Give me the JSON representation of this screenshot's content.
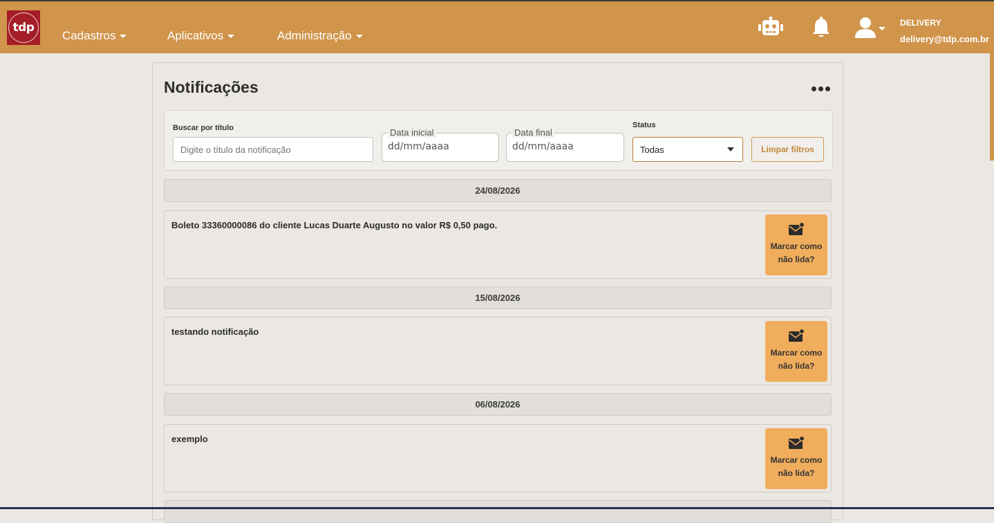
{
  "navbar": {
    "logo_text": "tdp",
    "menus": [
      {
        "label": "Cadastros"
      },
      {
        "label": "Aplicativos"
      },
      {
        "label": "Administração"
      }
    ],
    "icons": [
      "robot-icon",
      "bell-icon",
      "user-icon"
    ],
    "user": {
      "name": "DELIVERY",
      "email": "delivery@tdp.com.br"
    }
  },
  "page": {
    "title": "Notificações"
  },
  "filters": {
    "search_label": "Buscar por título",
    "search_placeholder": "Digite o título da notificação",
    "search_value": "",
    "start_date_label": "Data inicial",
    "start_date_value": "dd/mm/aaaa",
    "end_date_label": "Data final",
    "end_date_value": "dd/mm/aaaa",
    "status_label": "Status",
    "status_value": "Todas",
    "clear_label": "Limpar filtros"
  },
  "groups": [
    {
      "date": "24/08/2026",
      "items": [
        {
          "text": "Boleto 33360000086 do cliente Lucas Duarte Augusto no valor R$ 0,50 pago.",
          "action": "Marcar como não lida?"
        }
      ]
    },
    {
      "date": "15/08/2026",
      "items": [
        {
          "text": "testando notificação",
          "action": "Marcar como não lida?"
        }
      ]
    },
    {
      "date": "06/08/2026",
      "items": [
        {
          "text": "exemplo",
          "action": "Marcar como não lida?"
        }
      ]
    }
  ],
  "colors": {
    "navbar": "#d0944b",
    "accent_button": "#f0ad5c",
    "background": "#ebe8e3",
    "logo_bg": "#a51d27"
  }
}
